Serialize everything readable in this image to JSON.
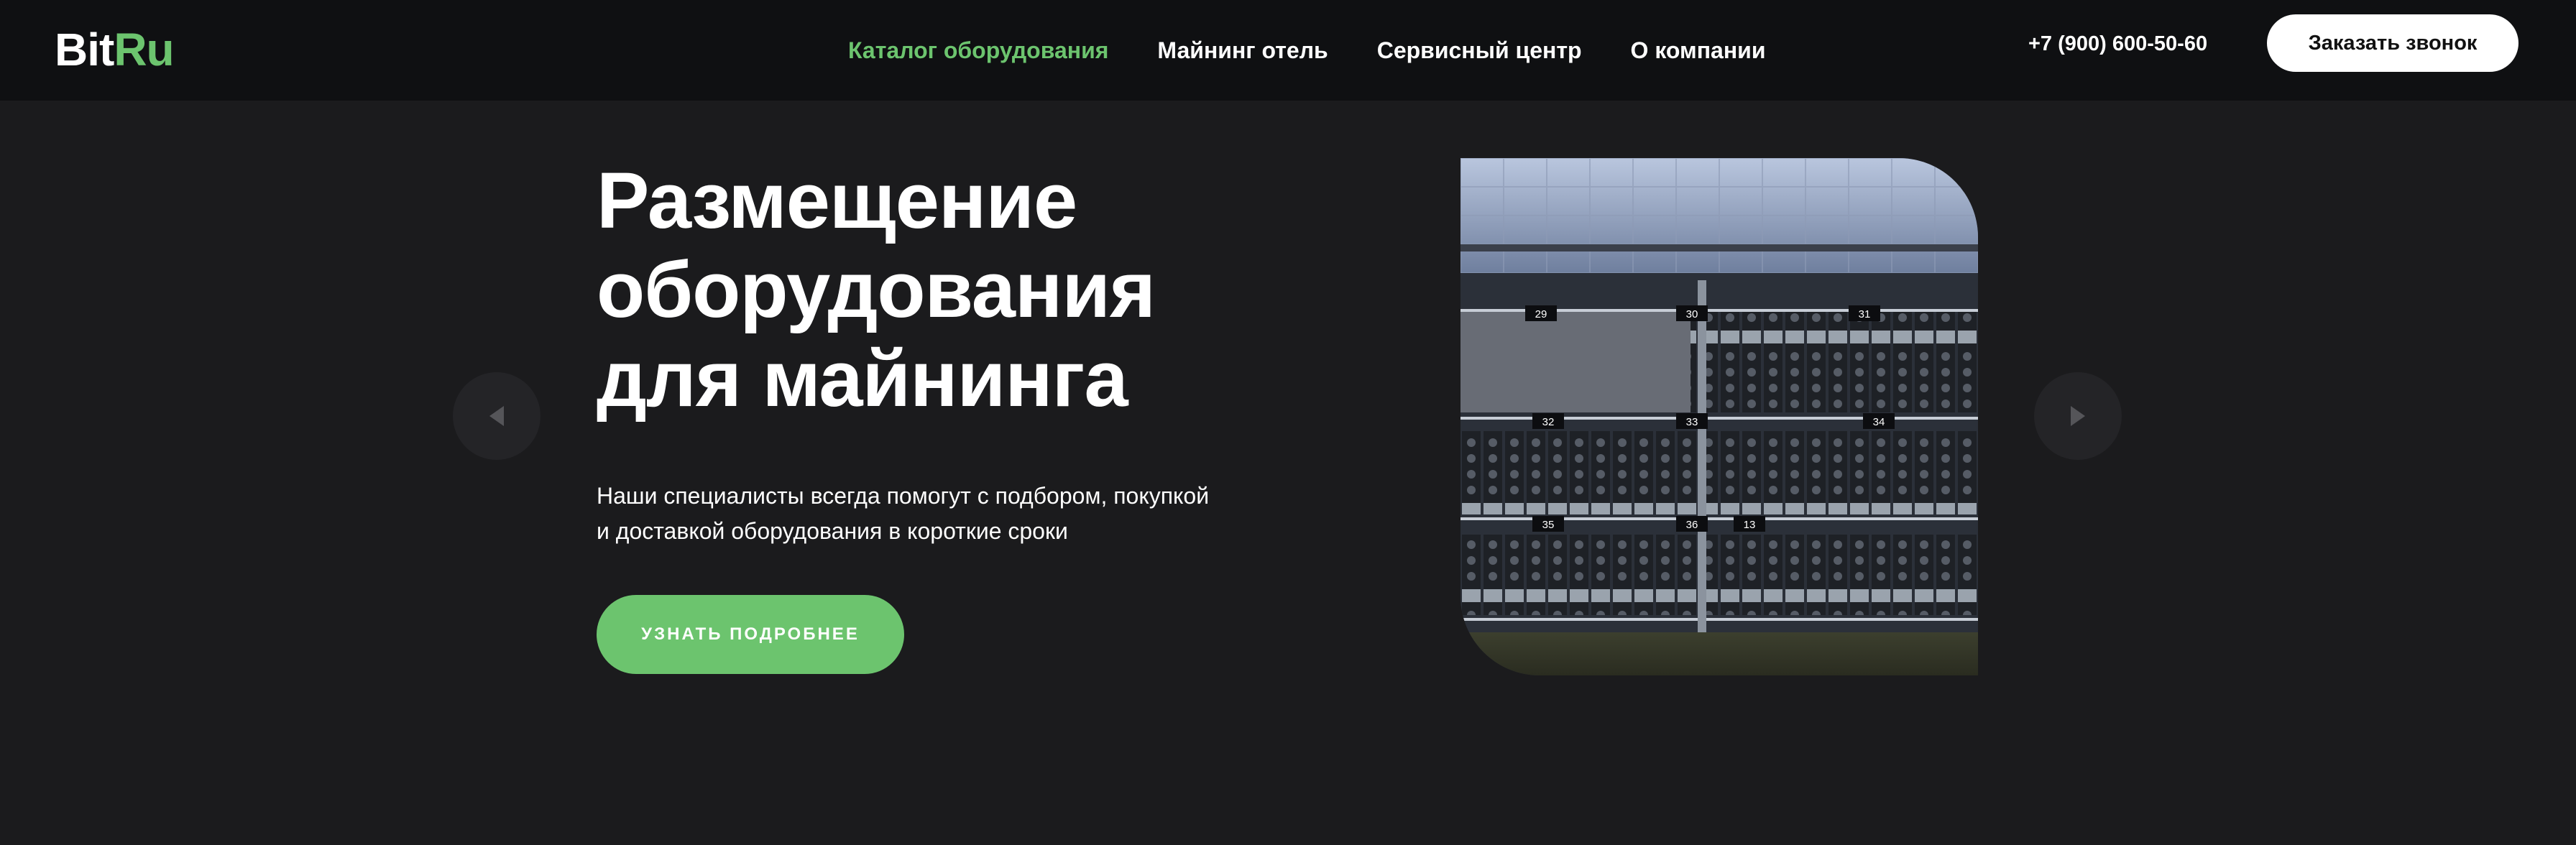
{
  "header": {
    "logo": {
      "part1": "Bit",
      "part2": "Ru"
    },
    "nav": [
      {
        "label": "Каталог оборудования",
        "active": true
      },
      {
        "label": "Майнинг отель",
        "active": false
      },
      {
        "label": "Сервисный центр",
        "active": false
      },
      {
        "label": "О компании",
        "active": false
      }
    ],
    "phone": "+7 (900) 600-50-60",
    "callback_label": "Заказать звонок"
  },
  "hero": {
    "title_lines": [
      "Размещение",
      "оборудования",
      "для майнинга"
    ],
    "text_lines": [
      "Наши специалисты всегда помогут с подбором, покупкой",
      "и доставкой оборудования в короткие сроки"
    ],
    "cta_label": "УЗНАТЬ ПОДРОБНЕЕ",
    "image_labels": [
      "29",
      "30",
      "31",
      "32",
      "33",
      "34",
      "35",
      "36",
      "13"
    ],
    "slider": {
      "prev_icon": "caret-left-icon",
      "next_icon": "caret-right-icon"
    }
  },
  "colors": {
    "accent": "#6cc46e",
    "background": "#1b1b1d",
    "header_background": "#0f1012"
  }
}
